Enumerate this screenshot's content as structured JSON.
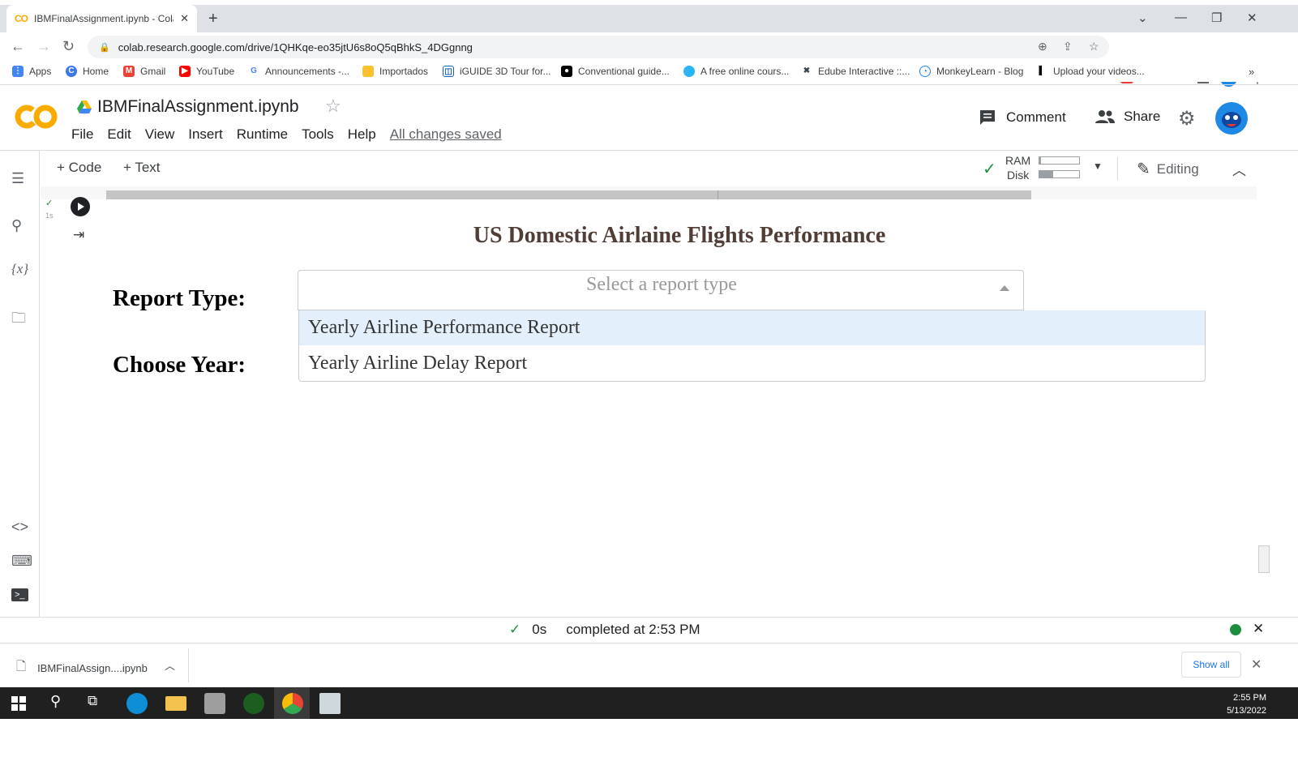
{
  "browser": {
    "tab_title": "IBMFinalAssignment.ipynb - Cola",
    "url": "colab.research.google.com/drive/1QHKqe-eo35jtU6s8oQ5qBhkS_4DGgnng"
  },
  "bookmarks": [
    {
      "label": "Apps",
      "icon": "apps-grid-icon",
      "color": "#4285f4"
    },
    {
      "label": "Home",
      "icon": "home-icon",
      "color": "#3b78e7"
    },
    {
      "label": "Gmail",
      "icon": "gmail-icon",
      "color": "#ea4335"
    },
    {
      "label": "YouTube",
      "icon": "youtube-icon",
      "color": "#ff0000"
    },
    {
      "label": "Announcements -...",
      "icon": "google-icon",
      "color": "#4285f4"
    },
    {
      "label": "Importados",
      "icon": "folder-icon",
      "color": "#fbc02d"
    },
    {
      "label": "iGUIDE 3D Tour for...",
      "icon": "iguide-icon",
      "color": "#1565c0"
    },
    {
      "label": "Conventional guide...",
      "icon": "medium-icon",
      "color": "#000000"
    },
    {
      "label": "A free online cours...",
      "icon": "course-icon",
      "color": "#29b6f6"
    },
    {
      "label": "Edube Interactive ::...",
      "icon": "edube-icon",
      "color": "#37474f"
    },
    {
      "label": "MonkeyLearn - Blog",
      "icon": "monkeylearn-icon",
      "color": "#1e88e5"
    },
    {
      "label": "Upload your videos...",
      "icon": "upload-icon",
      "color": "#000000"
    }
  ],
  "colab": {
    "notebook_title": "IBMFinalAssignment.ipynb",
    "menu": [
      "File",
      "Edit",
      "View",
      "Insert",
      "Runtime",
      "Tools",
      "Help"
    ],
    "save_status": "All changes saved",
    "comment_label": "Comment",
    "share_label": "Share",
    "add_code_label": "+ Code",
    "add_text_label": "+ Text",
    "ram_label": "RAM",
    "disk_label": "Disk",
    "ram_usage": 0.05,
    "disk_usage": 0.35,
    "editing_label": "Editing",
    "exec_time": "1s"
  },
  "dashboard": {
    "title": "US Domestic Airlaine Flights Performance",
    "report_type_label": "Report Type:",
    "choose_year_label": "Choose Year:",
    "select_placeholder": "Select a report type",
    "options": [
      "Yearly Airline Performance Report",
      "Yearly Airline Delay Report"
    ]
  },
  "status_bar": {
    "duration": "0s",
    "message": "completed at 2:53 PM"
  },
  "downloads": {
    "file_name": "IBMFinalAssign....ipynb",
    "show_all_label": "Show all"
  },
  "taskbar": {
    "time": "2:55 PM",
    "date": "5/13/2022"
  }
}
